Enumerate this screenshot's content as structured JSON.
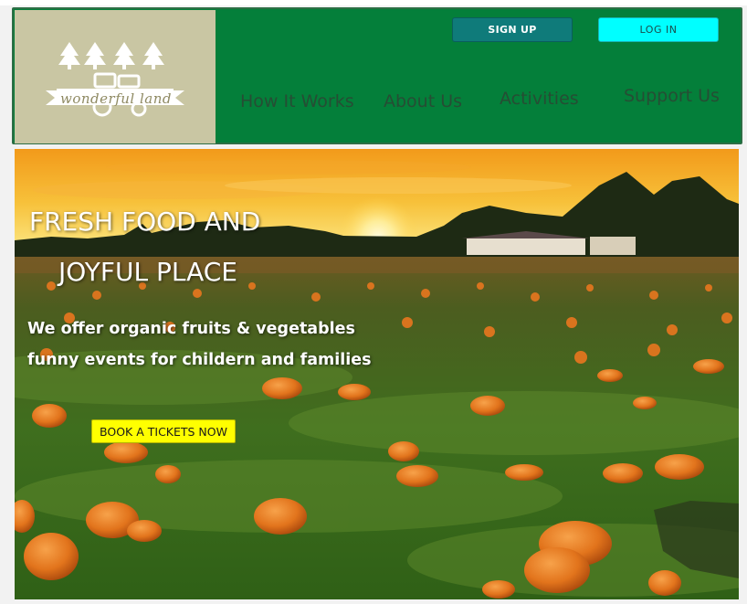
{
  "header": {
    "logo_text": "wonderful land",
    "signup_label": "SIGN UP",
    "login_label": "LOG IN",
    "nav": [
      {
        "label": "How It Works"
      },
      {
        "label": "About Us"
      },
      {
        "label": "Activities"
      },
      {
        "label": "Support Us"
      }
    ]
  },
  "hero": {
    "title_line1": "FRESH FOOD AND",
    "title_line2": "JOYFUL PLACE",
    "subtitle_line1": "We offer organic fruits & vegetables",
    "subtitle_line2": "funny events for childern and families",
    "book_label": "BOOK A TICKETS NOW",
    "image": "pumpkin-field-sunset-photo"
  },
  "colors": {
    "header_bg": "#047f3a",
    "logo_bg": "#c9c6a3",
    "signup_bg": "#0f7b7a",
    "login_bg": "#00ffff",
    "nav_text": "#264d34",
    "book_bg": "#ffff00"
  }
}
